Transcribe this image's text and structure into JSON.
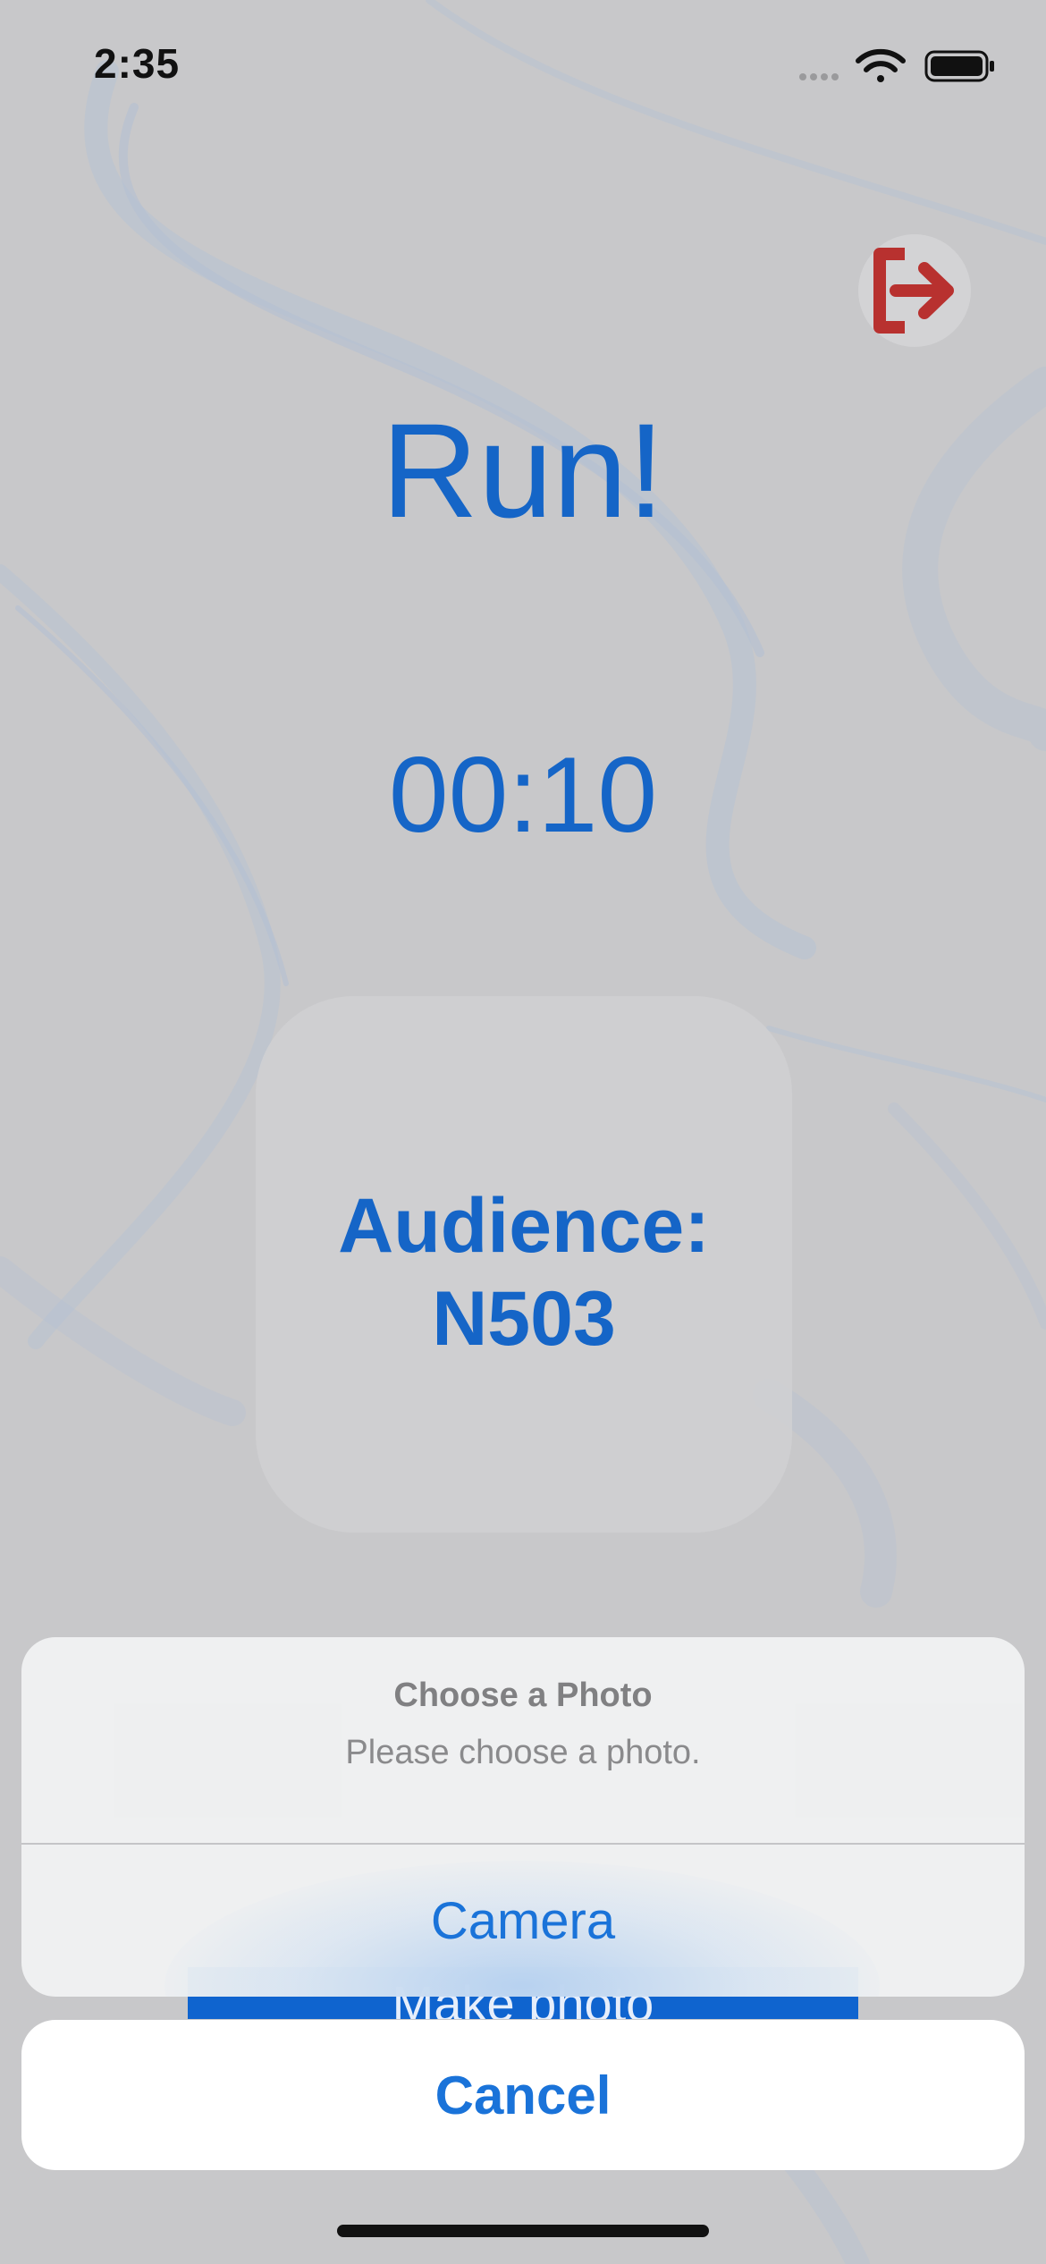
{
  "status_bar": {
    "time": "2:35",
    "icons": [
      "signal-dots-icon",
      "wifi-icon",
      "battery-icon"
    ]
  },
  "header": {
    "exit_icon": "logout-icon",
    "exit_color": "#b8312f"
  },
  "main": {
    "title": "Run!",
    "timer": "00:10",
    "audience_label": "Audience:",
    "audience_value": "N503",
    "make_photo_label": "Make photo"
  },
  "action_sheet": {
    "title": "Choose a Photo",
    "message": "Please choose a photo.",
    "options": [
      {
        "label": "Camera"
      }
    ],
    "cancel_label": "Cancel"
  },
  "colors": {
    "accent": "#1565c7",
    "action_blue": "#1a73d9",
    "button_blue": "#0f64cf",
    "background": "#c8c8ca"
  }
}
